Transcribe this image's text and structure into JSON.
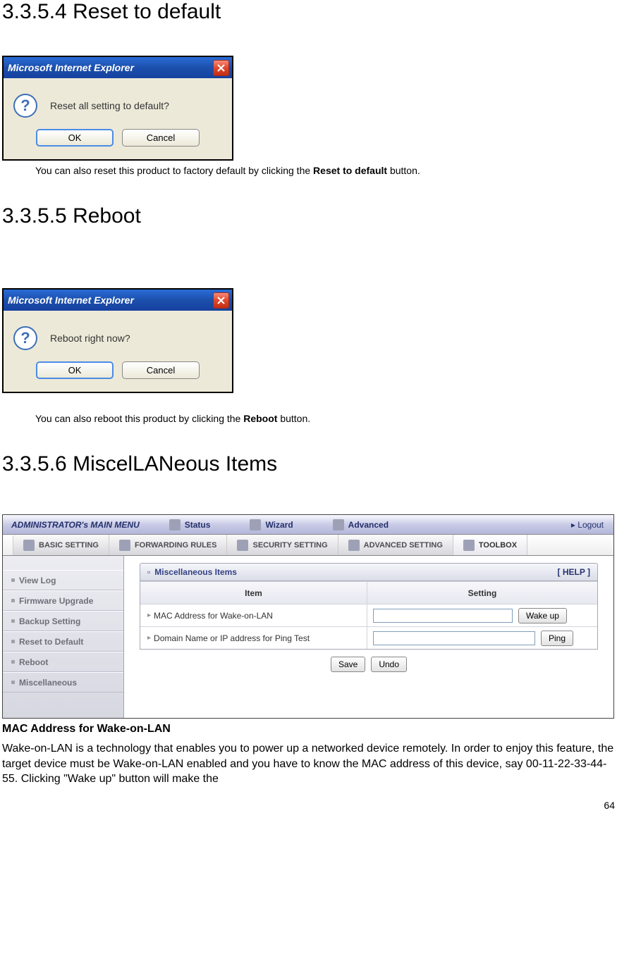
{
  "sections": {
    "s1": {
      "heading": "3.3.5.4 Reset to default",
      "dialog": {
        "title": "Microsoft Internet Explorer",
        "message": "Reset all setting to default?",
        "ok": "OK",
        "cancel": "Cancel"
      },
      "caption_prefix": "You can also reset this product to factory default by clicking the ",
      "caption_bold": "Reset to default",
      "caption_suffix": " button."
    },
    "s2": {
      "heading": "3.3.5.5 Reboot",
      "dialog": {
        "title": "Microsoft Internet Explorer",
        "message": "Reboot right now?",
        "ok": "OK",
        "cancel": "Cancel"
      },
      "caption_prefix": "You can also reboot this product by clicking the ",
      "caption_bold": "Reboot",
      "caption_suffix": " button."
    },
    "s3": {
      "heading": "3.3.5.6 MiscelLANeous Items"
    }
  },
  "admin": {
    "menu_title": "ADMINISTRATOR's MAIN MENU",
    "status": "Status",
    "wizard": "Wizard",
    "advanced": "Advanced",
    "logout_marker": "▸",
    "logout": "Logout",
    "tabs": {
      "basic": "BASIC SETTING",
      "forwarding": "FORWARDING RULES",
      "security": "SECURITY SETTING",
      "advanced": "ADVANCED SETTING",
      "toolbox": "TOOLBOX"
    },
    "sidebar": {
      "view_log": "View Log",
      "firmware": "Firmware Upgrade",
      "backup": "Backup Setting",
      "reset": "Reset to Default",
      "reboot": "Reboot",
      "misc": "Miscellaneous"
    },
    "panel": {
      "title": "Miscellaneous Items",
      "help": "[ HELP ]",
      "col_item": "Item",
      "col_setting": "Setting",
      "row1_label": "MAC Address for Wake-on-LAN",
      "row1_btn": "Wake up",
      "row2_label": "Domain Name or IP address for Ping Test",
      "row2_btn": "Ping",
      "save": "Save",
      "undo": "Undo",
      "square": "▫",
      "triangle": "▸"
    }
  },
  "content": {
    "subhead": "MAC Address for Wake-on-LAN",
    "body": "Wake-on-LAN is a technology that enables you to power up a networked device remotely. In order to enjoy this feature, the target device must be Wake-on-LAN enabled and you have to know the MAC address of this device, say 00-11-22-33-44-55. Clicking \"Wake up\" button will make the"
  },
  "page_number": "64"
}
